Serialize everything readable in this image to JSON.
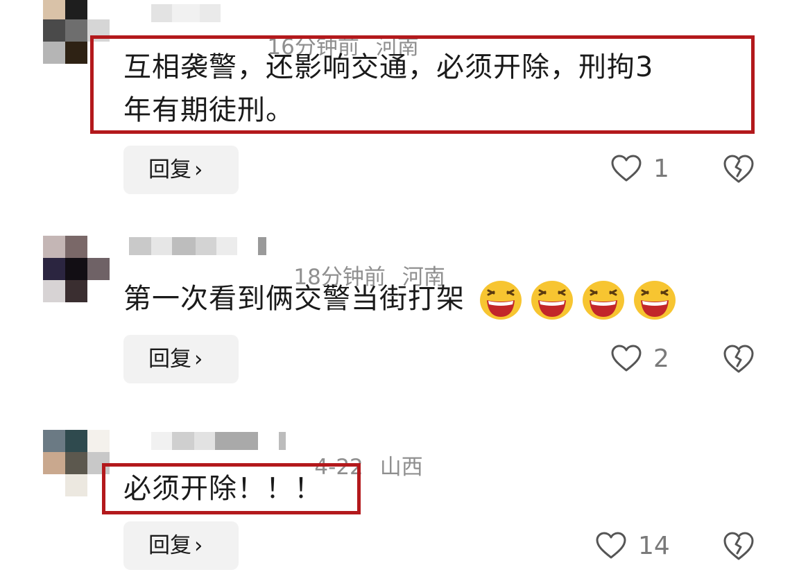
{
  "comments": [
    {
      "time": "16分钟前",
      "location": "河南",
      "text_line1": "互相袭警，还影响交通，必须开除，刑拘3",
      "text_line2": "年有期徒刑。",
      "reply_label": "回复",
      "reply_chevron": "›",
      "likes": "1",
      "highlighted": true
    },
    {
      "time": "18分钟前",
      "location": "河南",
      "text": "第一次看到俩交警当街打架",
      "emojis": [
        "laughing-emoji",
        "laughing-emoji",
        "laughing-emoji",
        "laughing-emoji"
      ],
      "reply_label": "回复",
      "reply_chevron": "›",
      "likes": "2",
      "highlighted": false
    },
    {
      "time": "4-22",
      "location": "山西",
      "text": "必须开除！！！",
      "reply_label": "回复",
      "reply_chevron": "›",
      "likes": "14",
      "highlighted": true
    }
  ],
  "icons": {
    "like": "heart-outline-icon",
    "dislike": "broken-heart-icon"
  },
  "colors": {
    "highlight_border": "#b3191c",
    "meta_text": "#8f8f8f",
    "reply_bg": "#f2f2f2",
    "icon_stroke": "#555555",
    "emoji_face": "#f7c531"
  }
}
